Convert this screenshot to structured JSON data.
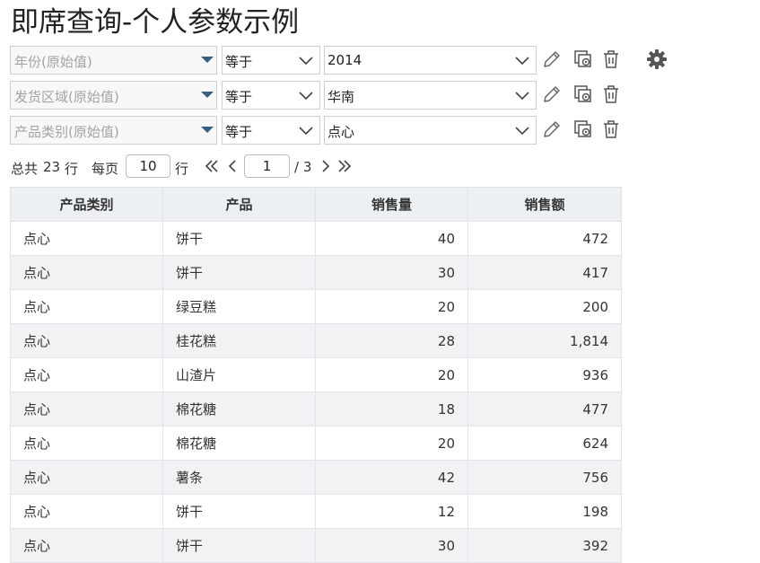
{
  "page": {
    "title": "即席查询-个人参数示例"
  },
  "filters": [
    {
      "field_placeholder": "年份(原始值)",
      "operator": "等于",
      "value": "2014"
    },
    {
      "field_placeholder": "发货区域(原始值)",
      "operator": "等于",
      "value": "华南"
    },
    {
      "field_placeholder": "产品类别(原始值)",
      "operator": "等于",
      "value": "点心"
    }
  ],
  "icons": {
    "edit": "pencil-icon",
    "settings_copy": "copy-settings-icon",
    "delete": "trash-icon",
    "gear": "gear-icon"
  },
  "pager": {
    "total_prefix": "总共",
    "total_count": "23",
    "total_suffix": "行",
    "per_page_label": "每页",
    "per_page_value": "10",
    "per_page_suffix": "行",
    "current_page": "1",
    "total_pages": "/ 3"
  },
  "table": {
    "headers": [
      "产品类别",
      "产品",
      "销售量",
      "销售额"
    ],
    "rows": [
      [
        "点心",
        "饼干",
        "40",
        "472"
      ],
      [
        "点心",
        "饼干",
        "30",
        "417"
      ],
      [
        "点心",
        "绿豆糕",
        "20",
        "200"
      ],
      [
        "点心",
        "桂花糕",
        "28",
        "1,814"
      ],
      [
        "点心",
        "山渣片",
        "20",
        "936"
      ],
      [
        "点心",
        "棉花糖",
        "18",
        "477"
      ],
      [
        "点心",
        "棉花糖",
        "20",
        "624"
      ],
      [
        "点心",
        "薯条",
        "42",
        "756"
      ],
      [
        "点心",
        "饼干",
        "12",
        "198"
      ],
      [
        "点心",
        "饼干",
        "30",
        "392"
      ]
    ]
  },
  "colors": {
    "caret": "#375f82",
    "icon": "#555555",
    "header_bg": "#edf0f3",
    "alt_row_bg": "#f1f2f4"
  }
}
